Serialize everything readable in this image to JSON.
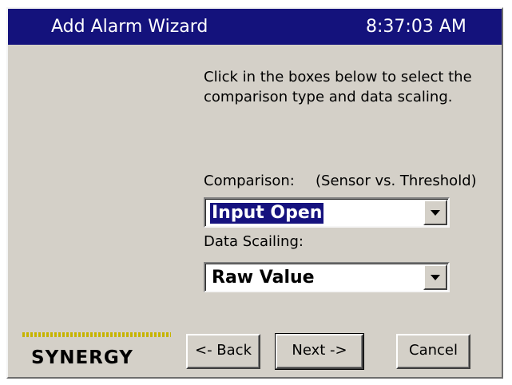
{
  "window": {
    "title": "Add Alarm Wizard",
    "time": "8:37:03 AM"
  },
  "instructions": "Click in the boxes below to select the comparison type and data scaling.",
  "comparison": {
    "label": "Comparison:",
    "hint": "(Sensor vs. Threshold)",
    "value": "Input Open"
  },
  "scaling": {
    "label": "Data Scailing:",
    "value": "Raw Value"
  },
  "logo": {
    "text": "SYNERGY"
  },
  "buttons": {
    "back": "<- Back",
    "next": "Next ->",
    "cancel": "Cancel"
  },
  "colors": {
    "titlebar": "#14127c",
    "window": "#d4d0c8",
    "selection": "#16127e",
    "logo_dots": "#c6b400"
  }
}
